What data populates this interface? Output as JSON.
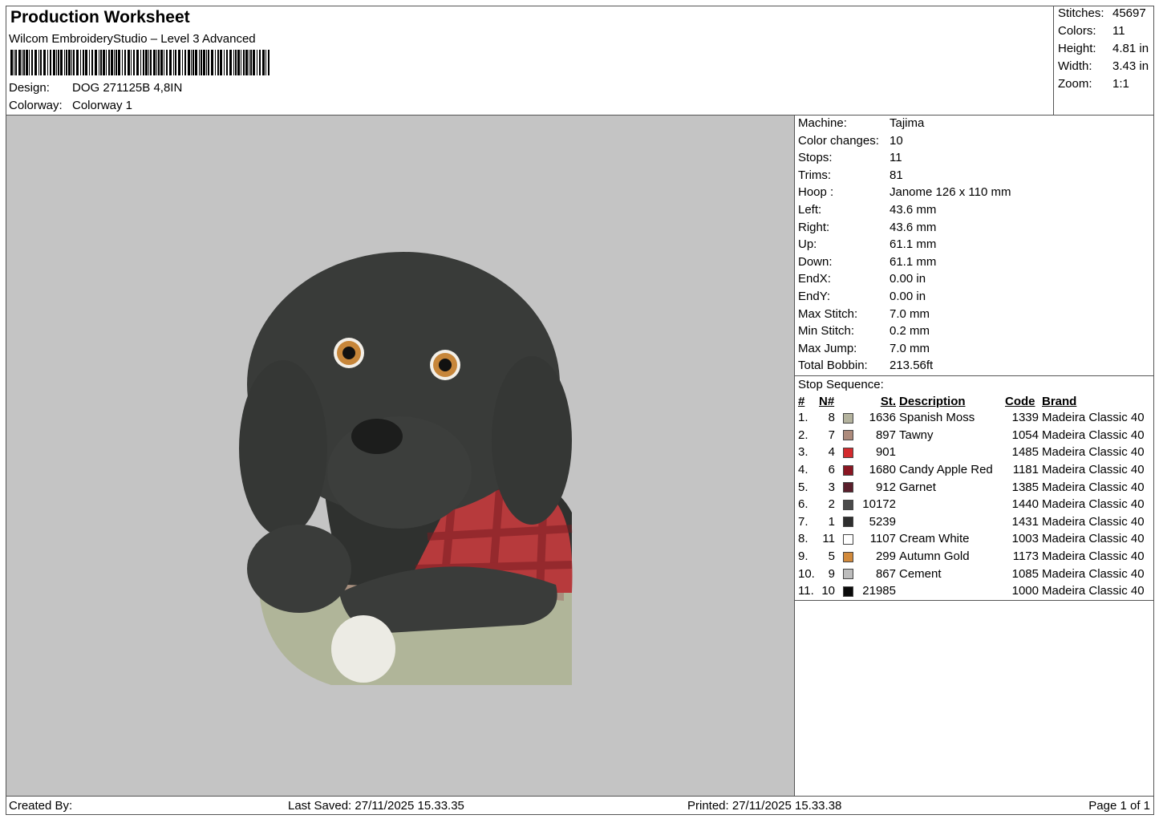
{
  "header": {
    "title": "Production Worksheet",
    "software": "Wilcom EmbroideryStudio – Level 3 Advanced",
    "design_label": "Design:",
    "design_value": "DOG 271125B 4,8IN",
    "colorway_label": "Colorway:",
    "colorway_value": "Colorway 1"
  },
  "summary": {
    "stitches_label": "Stitches:",
    "stitches_value": "45697",
    "colors_label": "Colors:",
    "colors_value": "11",
    "height_label": "Height:",
    "height_value": "4.81 in",
    "width_label": "Width:",
    "width_value": "3.43 in",
    "zoom_label": "Zoom:",
    "zoom_value": "1:1"
  },
  "details": [
    {
      "label": "Machine:",
      "value": "Tajima"
    },
    {
      "label": "Color changes:",
      "value": "10"
    },
    {
      "label": "Stops:",
      "value": "11"
    },
    {
      "label": "Trims:",
      "value": "81"
    },
    {
      "label": "Hoop :",
      "value": "Janome 126 x 110 mm"
    },
    {
      "label": "Left:",
      "value": "43.6 mm"
    },
    {
      "label": "Right:",
      "value": "43.6 mm"
    },
    {
      "label": "Up:",
      "value": "61.1 mm"
    },
    {
      "label": "Down:",
      "value": "61.1 mm"
    },
    {
      "label": "EndX:",
      "value": "0.00 in"
    },
    {
      "label": "EndY:",
      "value": "0.00 in"
    },
    {
      "label": "Max Stitch:",
      "value": "7.0 mm"
    },
    {
      "label": "Min Stitch:",
      "value": "0.2 mm"
    },
    {
      "label": "Max Jump:",
      "value": "7.0 mm"
    },
    {
      "label": "Total Bobbin:",
      "value": "213.56ft"
    }
  ],
  "stop_sequence": {
    "title": "Stop Sequence:",
    "headers": {
      "num": "#",
      "n": "N#",
      "st": "St.",
      "desc": "Description",
      "code": "Code",
      "brand": "Brand"
    },
    "rows": [
      {
        "num": "1.",
        "n": "8",
        "color": "#b4b39e",
        "st": "1636",
        "desc": "Spanish Moss",
        "code": "1339",
        "brand": "Madeira Classic 40"
      },
      {
        "num": "2.",
        "n": "7",
        "color": "#ad8b7c",
        "st": "897",
        "desc": "Tawny",
        "code": "1054",
        "brand": "Madeira Classic 40"
      },
      {
        "num": "3.",
        "n": "4",
        "color": "#d42a2e",
        "st": "901",
        "desc": "",
        "code": "1485",
        "brand": "Madeira Classic 40"
      },
      {
        "num": "4.",
        "n": "6",
        "color": "#8a1622",
        "st": "1680",
        "desc": "Candy Apple Red",
        "code": "1181",
        "brand": "Madeira Classic 40"
      },
      {
        "num": "5.",
        "n": "3",
        "color": "#5a1f2c",
        "st": "912",
        "desc": "Garnet",
        "code": "1385",
        "brand": "Madeira Classic 40"
      },
      {
        "num": "6.",
        "n": "2",
        "color": "#4a4a4a",
        "st": "10172",
        "desc": "",
        "code": "1440",
        "brand": "Madeira Classic 40"
      },
      {
        "num": "7.",
        "n": "1",
        "color": "#2e2e2e",
        "st": "5239",
        "desc": "",
        "code": "1431",
        "brand": "Madeira Classic 40"
      },
      {
        "num": "8.",
        "n": "11",
        "color": "#ffffff",
        "st": "1107",
        "desc": "Cream White",
        "code": "1003",
        "brand": "Madeira Classic 40"
      },
      {
        "num": "9.",
        "n": "5",
        "color": "#d28a3c",
        "st": "299",
        "desc": "Autumn Gold",
        "code": "1173",
        "brand": "Madeira Classic 40"
      },
      {
        "num": "10.",
        "n": "9",
        "color": "#bdbdbd",
        "st": "867",
        "desc": "Cement",
        "code": "1085",
        "brand": "Madeira Classic 40"
      },
      {
        "num": "11.",
        "n": "10",
        "color": "#0a0a0a",
        "st": "21985",
        "desc": "",
        "code": "1000",
        "brand": "Madeira Classic 40"
      }
    ]
  },
  "footer": {
    "created_by": "Created By:",
    "last_saved": "Last Saved: 27/11/2025 15.33.35",
    "printed": "Printed: 27/11/2025 15.33.38",
    "page": "Page 1 of 1"
  }
}
